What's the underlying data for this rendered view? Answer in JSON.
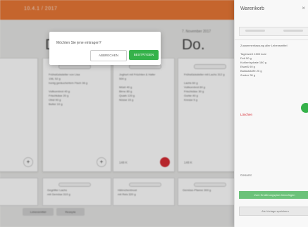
{
  "header": {
    "title": "10.4.1 / 2017"
  },
  "columns": [
    {
      "date": "",
      "day": ""
    },
    {
      "date": "",
      "day": "D"
    },
    {
      "date": "",
      "day": ""
    },
    {
      "date": "7. November 2017",
      "day": "Do."
    }
  ],
  "cards": [
    {
      "text": "",
      "kcal": "",
      "button": ""
    },
    {
      "text": "Frühstücksteller von Lisa\n156, 52 g\nhonig geräuchertem Fisch 36 g\n\nVollkornbrot 40 g\nFrischkäse 20 g\nObst 90 g\nButter 10 g",
      "kcal": "",
      "button": "+"
    },
    {
      "text": "Joghurt mit Früchten & Hafer\n500 g\n\nMüsli 40 g\nBirne 80 g\nQuark 120 g\nNüsse 15 g",
      "kcal": "148 K",
      "button": ""
    },
    {
      "text": "Frühstücksteller mit Lachs 312 g\n\nLachs 60 g\nVollkornbrot 60 g\nFrischkäse 30 g\nGurke 40 g\nKresse 5 g",
      "kcal": "148 K",
      "button": ""
    }
  ],
  "lower_cards": [
    {
      "text": ""
    },
    {
      "text": "Gegrillter Lachs\nmit Gemüse 310 g"
    },
    {
      "text": "Hähnchenbrust\nmit Reis 320 g"
    },
    {
      "text": "Gemüse-Pfanne 300 g"
    }
  ],
  "bottom_buttons": [
    "Lebensmittel",
    "Rezepte"
  ],
  "modal": {
    "question": "Möchten Sie jene eintragen?",
    "cancel": "ABBRECHEN",
    "confirm": "BESTÄTIGEN"
  },
  "panel": {
    "title": "Warenkorb",
    "close": "×",
    "body": "Zusammenfassung aller Lebensmittel\n\nTageswert 1500 kcal\nFett 50 g\nKohlenhydrate 180 g\nEiweiß 90 g\nBallaststoffe 25 g\nZucker 30 g",
    "link": "Löschen",
    "kcal_label": "Gesamt",
    "kcal_value": "",
    "add_button": "Zum Ernährungsplan hinzufügen",
    "alt_button": "Als Vorlage speichern"
  },
  "colors": {
    "accent": "#e8732f",
    "green": "#35b24a",
    "red": "#d6262e"
  }
}
